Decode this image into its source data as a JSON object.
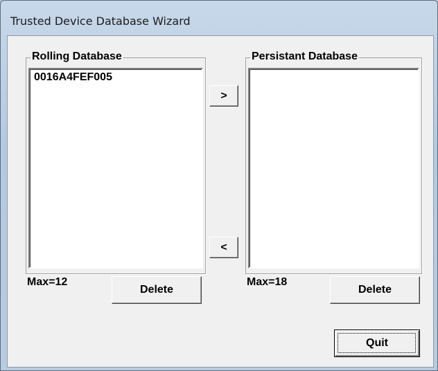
{
  "window": {
    "title": "Trusted Device Database Wizard"
  },
  "rolling": {
    "group_title": "Rolling Database",
    "items": [
      "0016A4FEF005"
    ],
    "max_label": "Max=12",
    "delete_label": "Delete"
  },
  "persistant": {
    "group_title": "Persistant Database",
    "items": [],
    "max_label": "Max=18",
    "delete_label": "Delete"
  },
  "transfer": {
    "move_right_label": ">",
    "move_left_label": "<"
  },
  "quit_label": "Quit"
}
